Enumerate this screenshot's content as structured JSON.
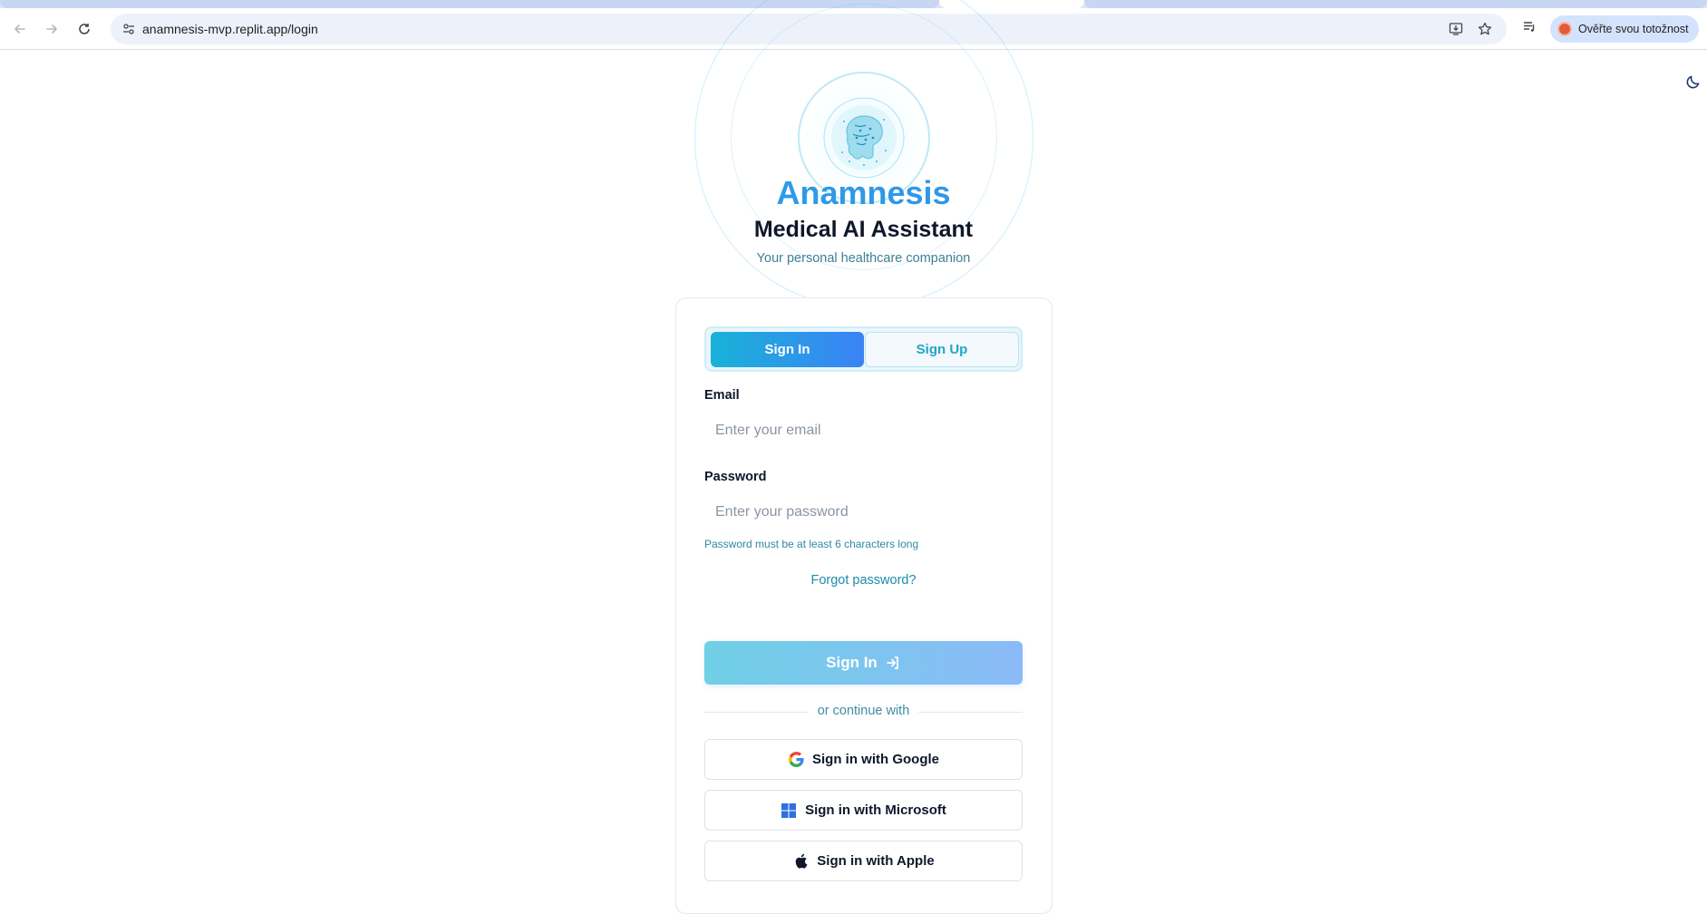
{
  "browser": {
    "url": "anamnesis-mvp.replit.app/login",
    "profile_label": "Ověřte svou totožnost"
  },
  "brand": {
    "title": "Anamnesis",
    "subtitle": "Medical AI Assistant",
    "tagline": "Your personal healthcare companion"
  },
  "auth_tabs": {
    "signin": "Sign In",
    "signup": "Sign Up",
    "active": "signin"
  },
  "form": {
    "email_label": "Email",
    "email_placeholder": "Enter your email",
    "email_value": "",
    "password_label": "Password",
    "password_placeholder": "Enter your password",
    "password_value": "",
    "password_hint": "Password must be at least 6 characters long",
    "forgot_password": "Forgot password?",
    "submit_label": "Sign In"
  },
  "sso": {
    "divider_text": "or continue with",
    "google": "Sign in with Google",
    "microsoft": "Sign in with Microsoft",
    "apple": "Sign in with Apple"
  },
  "colors": {
    "accent_start": "#19b2d8",
    "accent_end": "#3b82f6",
    "link": "#1c8bb0"
  },
  "icons": {
    "back": "arrow-left-icon",
    "forward": "arrow-right-icon",
    "reload": "reload-icon",
    "site_info": "tune-icon",
    "install": "install-icon",
    "bookmark": "star-icon",
    "media": "media-queue-icon",
    "theme": "moon-icon",
    "submit": "log-in-icon"
  }
}
